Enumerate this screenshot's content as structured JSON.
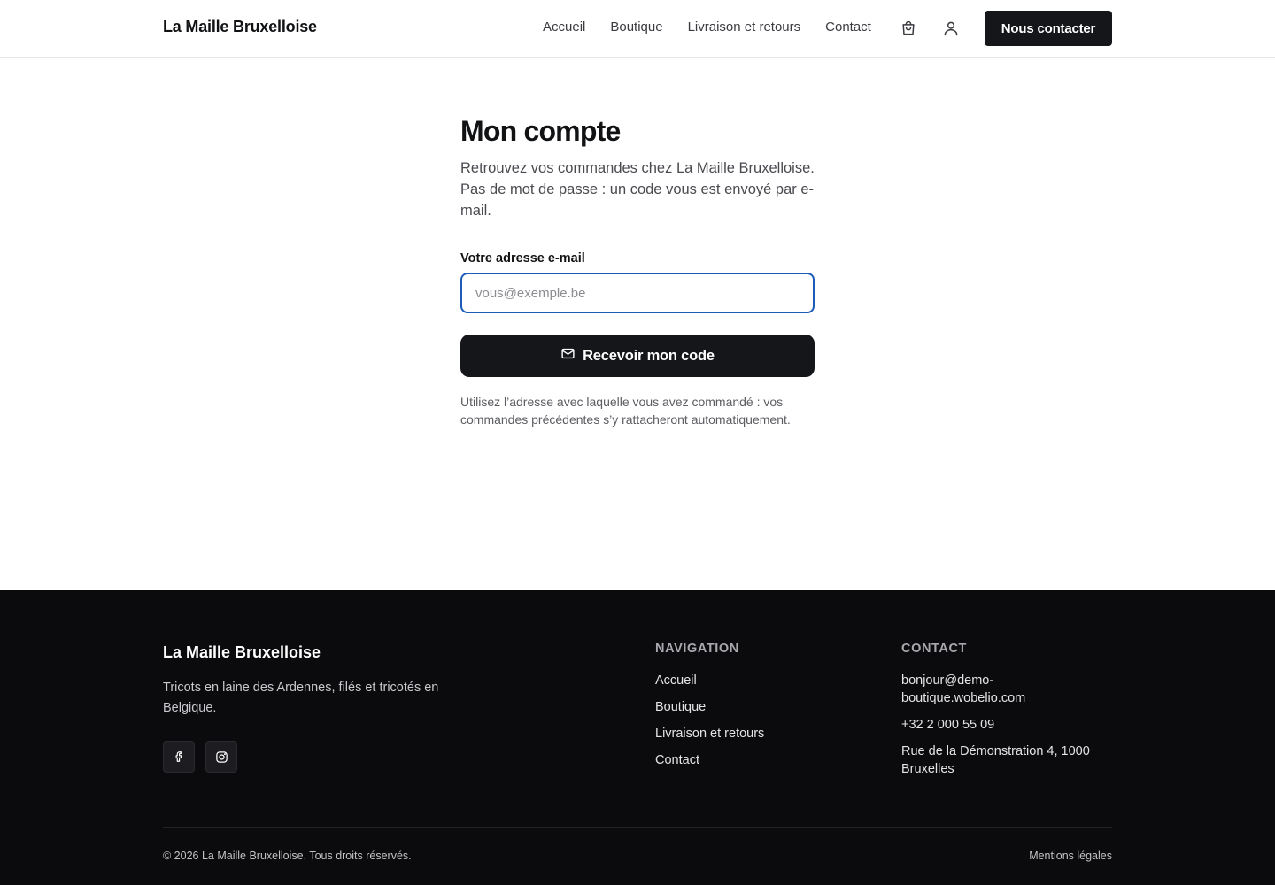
{
  "header": {
    "brand": "La Maille Bruxelloise",
    "nav": [
      {
        "label": "Accueil"
      },
      {
        "label": "Boutique"
      },
      {
        "label": "Livraison et retours"
      },
      {
        "label": "Contact"
      }
    ],
    "cart_icon": "shopping-bag-icon",
    "user_icon": "user-icon",
    "cta_label": "Nous contacter"
  },
  "main": {
    "title": "Mon compte",
    "intro": "Retrouvez vos commandes chez La Maille Bruxelloise. Pas de mot de passe : un code vous est envoyé par e-mail.",
    "email_label": "Votre adresse e-mail",
    "email_placeholder": "vous@exemple.be",
    "email_value": "",
    "submit_icon": "mail-icon",
    "submit_label": "Recevoir mon code",
    "hint": "Utilisez l’adresse avec laquelle vous avez commandé : vos commandes précédentes s’y rattacheront automatiquement."
  },
  "footer": {
    "brand": "La Maille Bruxelloise",
    "tagline": "Tricots en laine des Ardennes, filés et tricotés en Belgique.",
    "social": [
      "facebook-icon",
      "instagram-icon"
    ],
    "nav_title": "NAVIGATION",
    "nav_links": [
      {
        "label": "Accueil"
      },
      {
        "label": "Boutique"
      },
      {
        "label": "Livraison et retours"
      },
      {
        "label": "Contact"
      }
    ],
    "contact_title": "CONTACT",
    "contact_email": "bonjour@demo-boutique.wobelio.com",
    "contact_phone": "+32 2 000 55 09",
    "contact_address": "Rue de la Démonstration 4, 1000 Bruxelles",
    "copyright": "© 2026 La Maille Bruxelloise. Tous droits réservés.",
    "legal": "Mentions légales"
  },
  "colors": {
    "primary_dark": "#15161a",
    "focus_blue": "#1d5bb8",
    "footer_bg": "#0b0b0e"
  }
}
